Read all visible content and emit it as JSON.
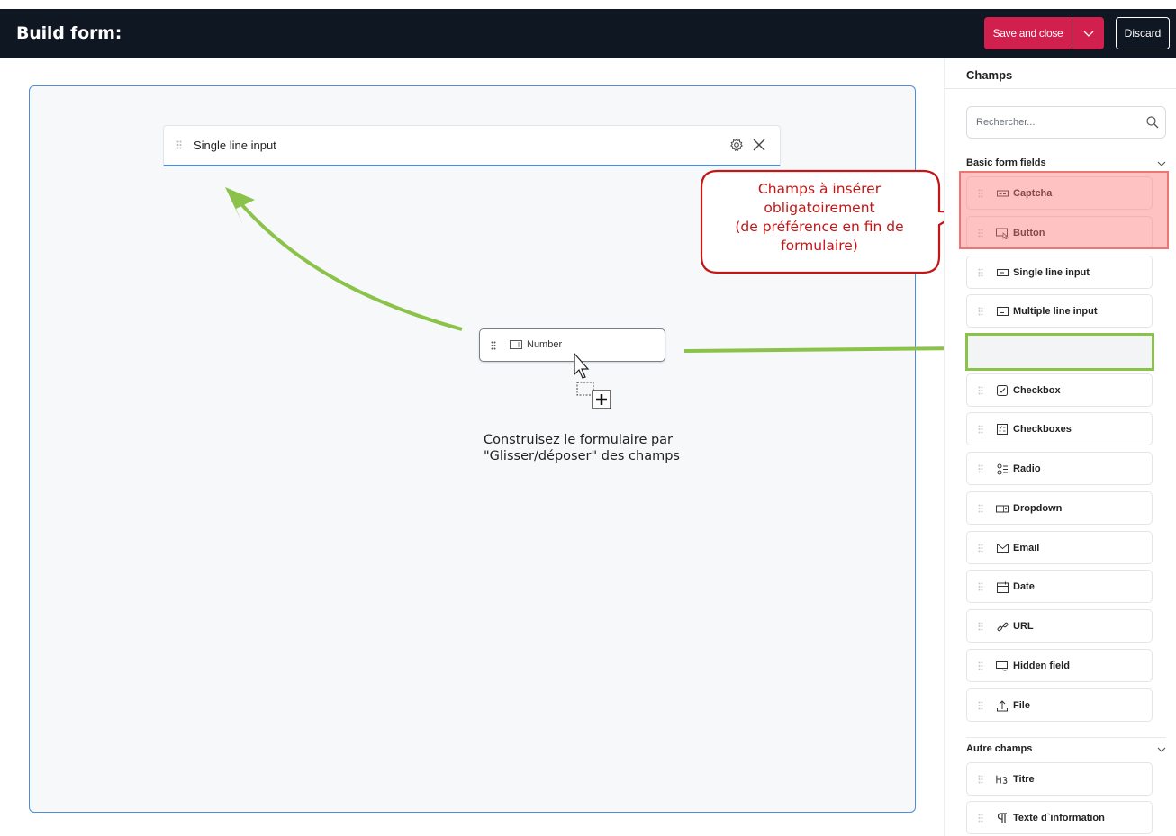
{
  "header": {
    "title": "Build form:",
    "save_label": "Save and close",
    "discard_label": "Discard",
    "colors": {
      "bar": "#0f1723",
      "save": "#d11f4e"
    }
  },
  "canvas": {
    "field_label": "Single line input",
    "dragging_label": "Number",
    "hint_line1": "Construisez le formulaire par",
    "hint_line2": "\"Glisser/déposer\" des champs"
  },
  "callout": {
    "line1": "Champs à insérer",
    "line2": "obligatoirement",
    "line3": "(de préférence en fin de",
    "line4": "formulaire)"
  },
  "sidebar": {
    "title": "Champs",
    "search_placeholder": "Rechercher...",
    "section_basic": "Basic form fields",
    "section_other": "Autre champs",
    "basic_items": [
      {
        "label": "Captcha",
        "icon": "captcha-icon"
      },
      {
        "label": "Button",
        "icon": "button-icon"
      },
      {
        "label": "Single line input",
        "icon": "single-line-input-icon"
      },
      {
        "label": "Multiple line input",
        "icon": "multiple-line-input-icon"
      },
      {
        "label": "Checkbox",
        "icon": "checkbox-icon"
      },
      {
        "label": "Checkboxes",
        "icon": "checkboxes-icon"
      },
      {
        "label": "Radio",
        "icon": "radio-icon"
      },
      {
        "label": "Dropdown",
        "icon": "dropdown-icon"
      },
      {
        "label": "Email",
        "icon": "email-icon"
      },
      {
        "label": "Date",
        "icon": "calendar-icon"
      },
      {
        "label": "URL",
        "icon": "link-icon"
      },
      {
        "label": "Hidden field",
        "icon": "hidden-field-icon"
      },
      {
        "label": "File",
        "icon": "upload-icon"
      }
    ],
    "other_items": [
      {
        "label": "Titre",
        "icon": "heading-icon"
      },
      {
        "label": "Texte d`information",
        "icon": "paragraph-icon"
      }
    ]
  },
  "annotation_colors": {
    "arrow": "#8bc34a",
    "callout": "#c41616"
  }
}
